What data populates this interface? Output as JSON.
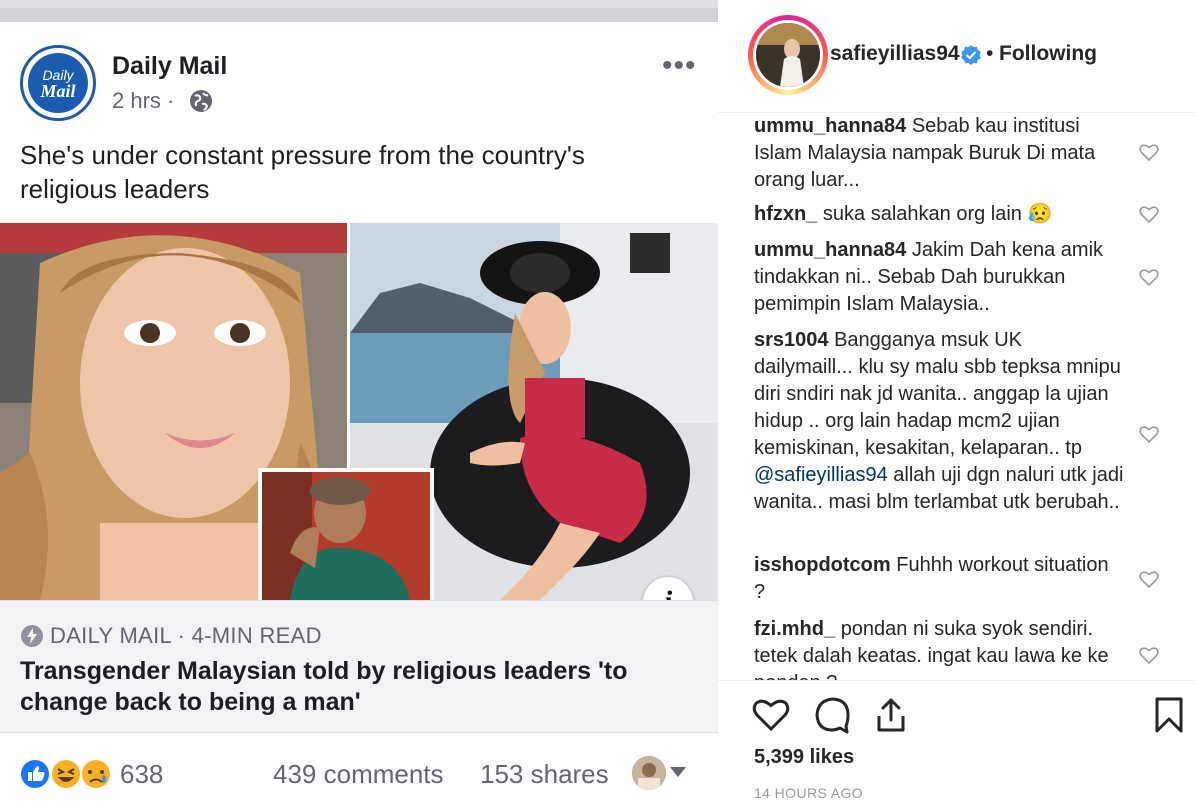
{
  "facebook": {
    "page_name": "Daily Mail",
    "logo_text": [
      "Daily",
      "Mail"
    ],
    "time": "2 hrs ·",
    "post_text": "She's under constant pressure from the country's religious leaders",
    "link_source": "DAILY MAIL · 4-MIN READ",
    "link_title": "Transgender Malaysian told by religious leaders 'to change back to being a man'",
    "reaction_count": "638",
    "comments": "439 comments",
    "shares": "153 shares",
    "icons": [
      "globe-icon",
      "more-options-icon",
      "info-icon",
      "lightning-icon",
      "like-reaction-icon",
      "haha-reaction-icon",
      "sad-reaction-icon",
      "dropdown-caret-icon"
    ]
  },
  "instagram": {
    "username": "safieyillias94",
    "separator": "•",
    "follow_status": "Following",
    "comments": [
      {
        "user": "ummu_hanna84",
        "text": "Sebab kau institusi Islam Malaysia nampak Buruk Di mata orang luar..."
      },
      {
        "user": "hfzxn_",
        "text": "suka salahkan org lain 😥"
      },
      {
        "user": "ummu_hanna84",
        "text": "Jakim Dah kena amik tindakkan ni.. Sebab Dah burukkan pemimpin Islam Malaysia.."
      },
      {
        "user": "srs1004",
        "text_before": "Bangganya msuk UK dailymaill... klu sy malu sbb tepksa mnipu diri sndiri nak jd wanita.. anggap la ujian hidup .. org lain hadap mcm2 ujian kemiskinan, kesakitan, kelaparan.. tp",
        "mention": "@safieyillias94",
        "text_after": "allah uji dgn naluri utk jadi wanita.. masi blm terlambat utk berubah.."
      },
      {
        "user": "isshopdotcom",
        "text": "Fuhhh workout situation ?"
      },
      {
        "user": "fzi.mhd_",
        "text": "pondan ni suka syok sendiri. tetek dalah keatas. ingat kau lawa ke ke pondan ?"
      }
    ],
    "likes": "5,399 likes",
    "time_ago": "14 HOURS AGO",
    "icons": [
      "verified-badge-icon",
      "heart-icon",
      "comment-icon",
      "share-icon",
      "bookmark-icon"
    ]
  }
}
